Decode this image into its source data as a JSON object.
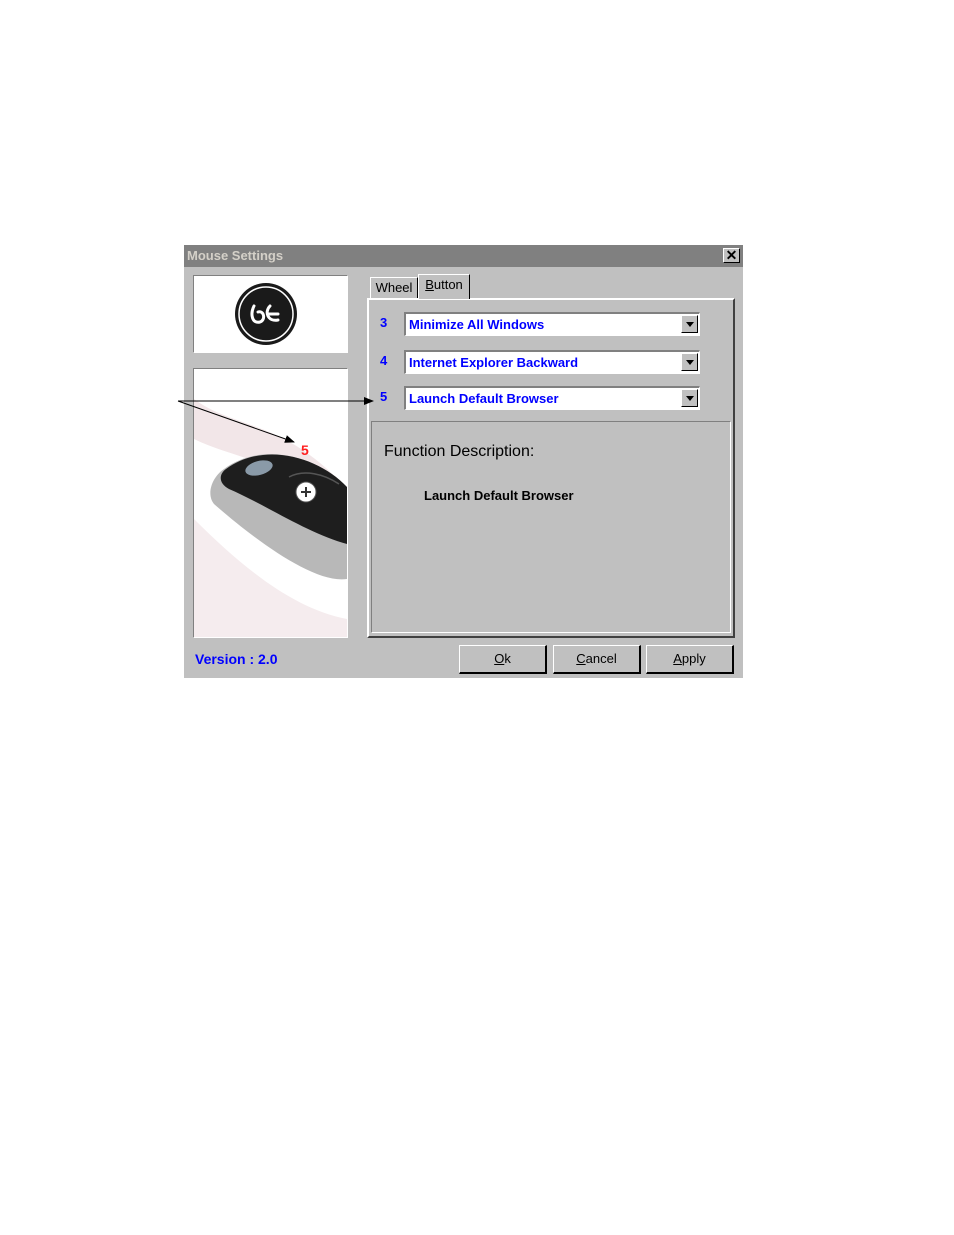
{
  "window": {
    "title": "Mouse Settings",
    "close_glyph": "✕"
  },
  "tabs": [
    {
      "label_rest": "Wheel",
      "active": false
    },
    {
      "label_accel": "B",
      "label_rest": "utton",
      "active": true
    }
  ],
  "buttons_config": [
    {
      "number": "3",
      "value": "Minimize All Windows"
    },
    {
      "number": "4",
      "value": "Internet Explorer Backward"
    },
    {
      "number": "5",
      "value": "Launch Default Browser"
    }
  ],
  "description": {
    "title": "Function Description:",
    "text": "Launch Default Browser"
  },
  "version": "Version : 2.0",
  "actions": {
    "ok": {
      "accel": "O",
      "rest": "k"
    },
    "cancel": {
      "accel": "C",
      "rest": "ancel"
    },
    "apply": {
      "accel": "A",
      "rest": "pply"
    }
  },
  "callout_label": "5",
  "colors": {
    "dialog_bg": "#c0c0c0",
    "titlebar_inactive": "#808080",
    "value_text": "#0000ff",
    "callout": "#ff2020"
  }
}
